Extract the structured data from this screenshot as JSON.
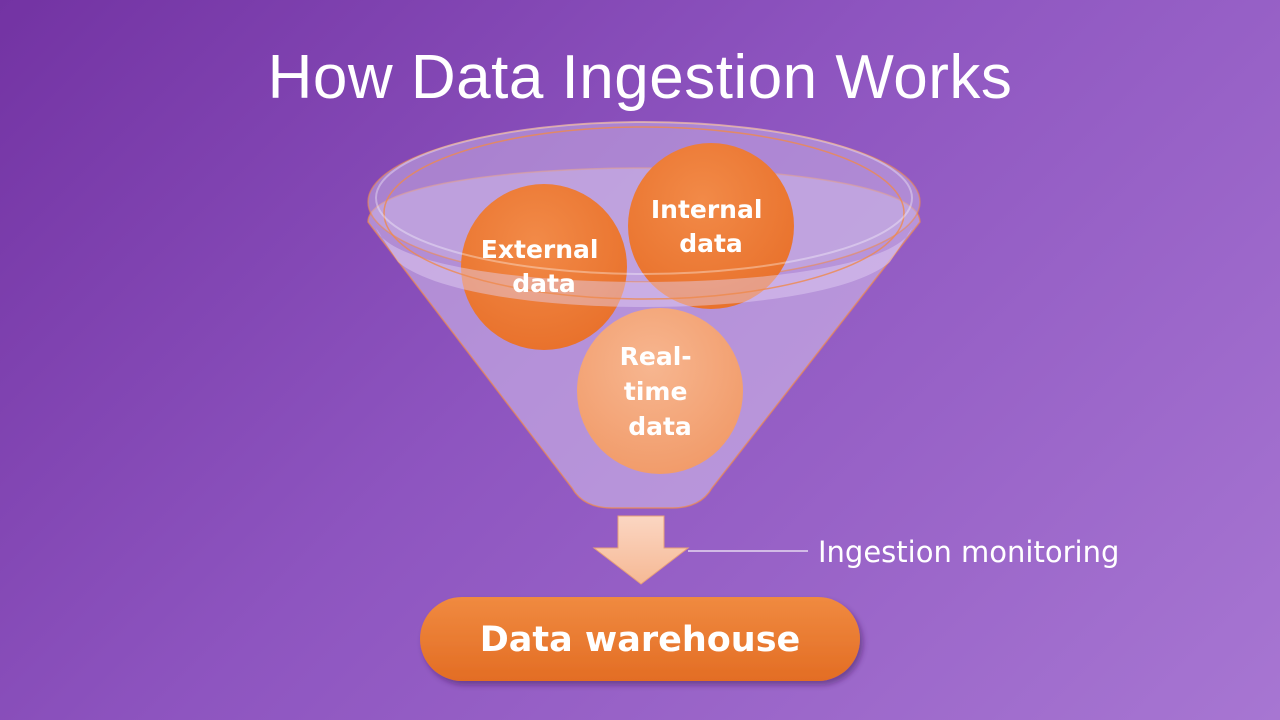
{
  "slide": {
    "title": "How Data Ingestion Works"
  },
  "sources": {
    "external": [
      "External",
      "data"
    ],
    "internal": [
      "Internal",
      "data"
    ],
    "realtime": [
      "Real-",
      "time",
      "data"
    ]
  },
  "monitoring_label": "Ingestion monitoring",
  "destination_label": "Data warehouse",
  "colors": {
    "background_start": "#7333a3",
    "background_end": "#a776d2",
    "funnel_fill": "#d6c3ec",
    "funnel_outline": "#ef8a4c",
    "bubble_dark": "#ee7a36",
    "bubble_light": "#f3a376",
    "warehouse": "#ec7a30",
    "arrow": "#f8c9ae"
  }
}
